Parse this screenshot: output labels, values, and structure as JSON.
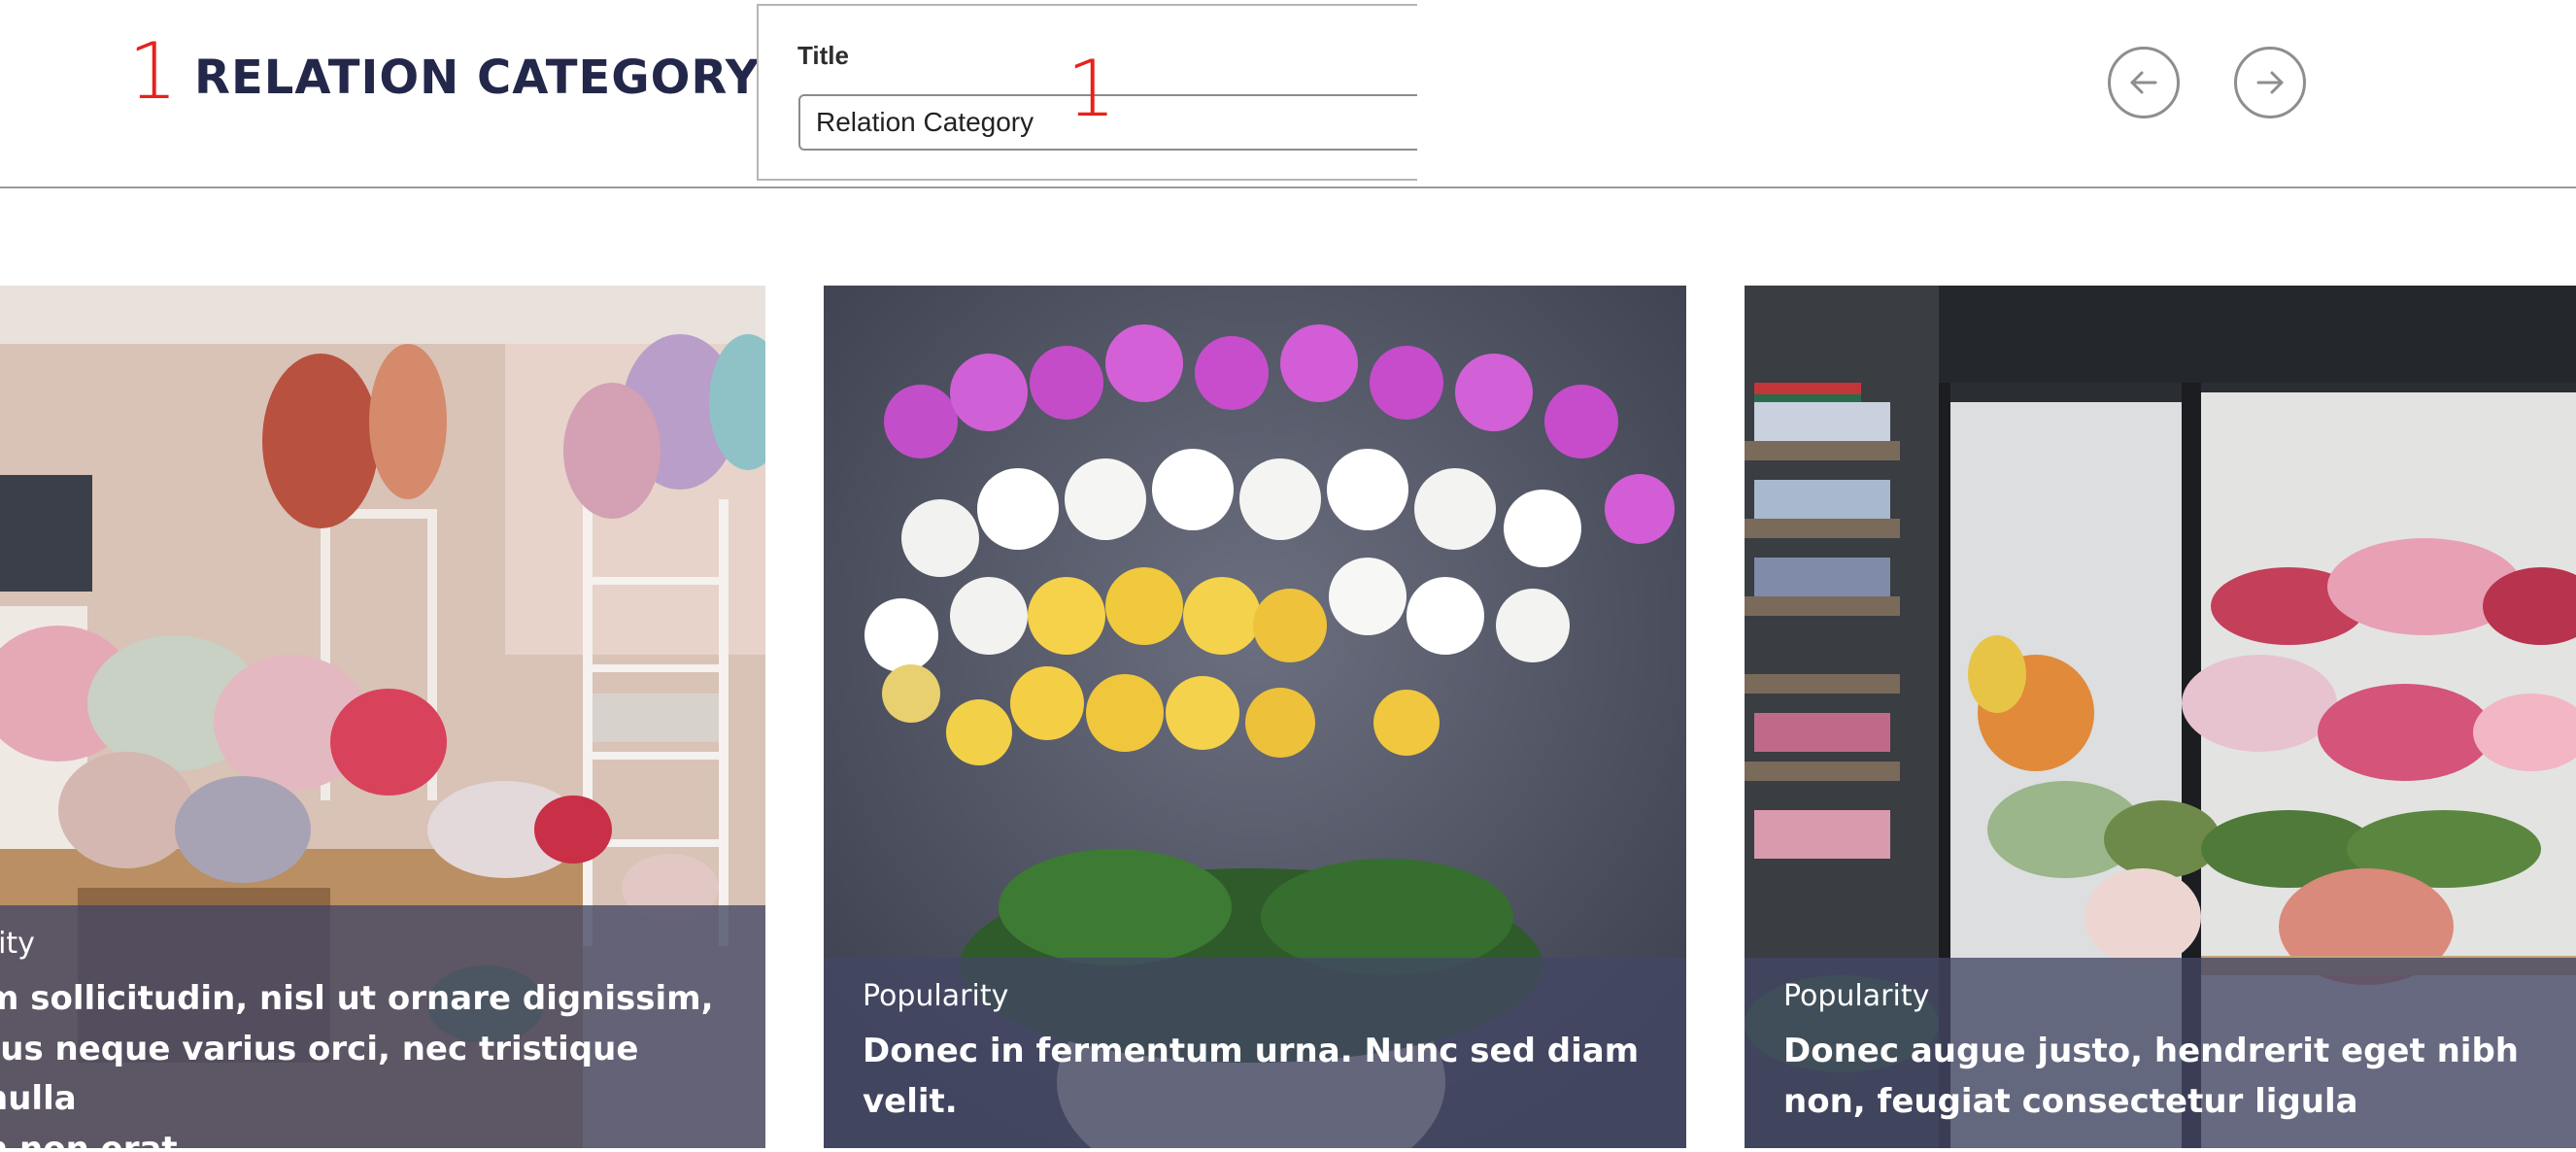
{
  "header": {
    "marker_left": "1",
    "marker_input": "1",
    "title": "RELATION CATEGORY",
    "field_label": "Title",
    "field_value": "Relation Category",
    "prev_icon": "arrow-left-icon",
    "next_icon": "arrow-right-icon"
  },
  "cards": [
    {
      "category": "ularity",
      "headline": "m sollicitudin, nisl ut ornare dignissim,\ntus neque varius orci, nec tristique nulla\nh non erat",
      "image": "flower-shop-interior"
    },
    {
      "category": "Popularity",
      "headline": "Donec in fermentum urna. Nunc sed diam velit.",
      "image": "orchid-arrangement"
    },
    {
      "category": "Popularity",
      "headline": "Donec augue justo, hendrerit eget nibh non, feugiat consectetur ligula",
      "image": "flower-shop-storefront"
    }
  ],
  "colors": {
    "title": "#23284a",
    "marker": "#e8211b",
    "overlay": "#424664"
  }
}
